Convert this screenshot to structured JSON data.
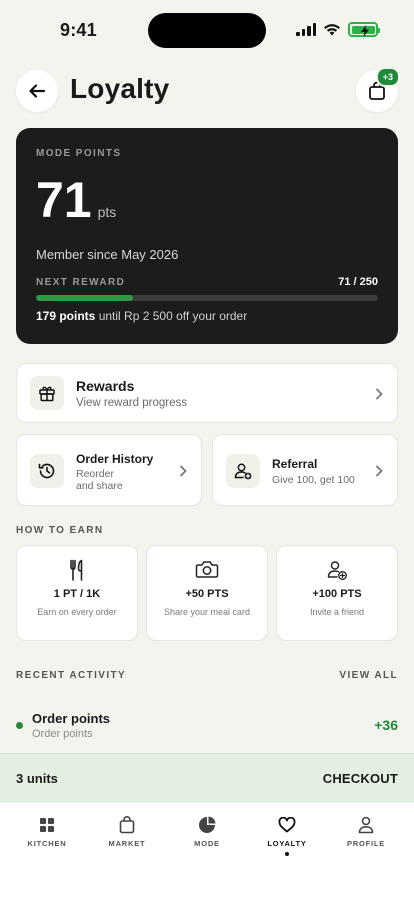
{
  "status": {
    "time": "9:41"
  },
  "header": {
    "title": "Loyalty",
    "bag_badge": "+3"
  },
  "points_card": {
    "label": "MODE POINTS",
    "value": "71",
    "unit": "pts",
    "member_since": "Member since May 2026",
    "next_reward_label": "NEXT REWARD",
    "progress_text": "71 / 250",
    "progress_fraction": 0.284,
    "until_points": "179 points",
    "until_rest": " until Rp 2 500 off your order"
  },
  "rewards": {
    "title": "Rewards",
    "subtitle": "View reward progress"
  },
  "order_history": {
    "title": "Order History",
    "subtitle_line1": "Reorder",
    "subtitle_line2": "and share"
  },
  "referral": {
    "title": "Referral",
    "subtitle": "Give 100, get 100"
  },
  "how_to_earn": {
    "label": "HOW TO EARN",
    "items": [
      {
        "icon": "cutlery-icon",
        "title": "1 PT / 1K",
        "subtitle": "Earn on every order"
      },
      {
        "icon": "camera-icon",
        "title": "+50 PTS",
        "subtitle": "Share your meal card"
      },
      {
        "icon": "add-user-icon",
        "title": "+100 PTS",
        "subtitle": "Invite a friend"
      }
    ]
  },
  "recent_activity": {
    "label": "RECENT ACTIVITY",
    "view_all": "VIEW ALL",
    "items": [
      {
        "title": "Order points",
        "subtitle": "Order points",
        "points": "+36"
      }
    ]
  },
  "checkout_bar": {
    "units": "3 units",
    "action": "CHECKOUT"
  },
  "tabs": [
    {
      "label": "KITCHEN",
      "icon": "grid-icon"
    },
    {
      "label": "MARKET",
      "icon": "bag-icon"
    },
    {
      "label": "MODE",
      "icon": "pie-icon"
    },
    {
      "label": "LOYALTY",
      "icon": "heart-icon",
      "active": true
    },
    {
      "label": "PROFILE",
      "icon": "person-icon"
    }
  ],
  "colors": {
    "accent": "#1f8a3a",
    "card_dark": "#1c1c1c",
    "background": "#f4f4ef",
    "checkout_bg": "#e3f0e1"
  }
}
